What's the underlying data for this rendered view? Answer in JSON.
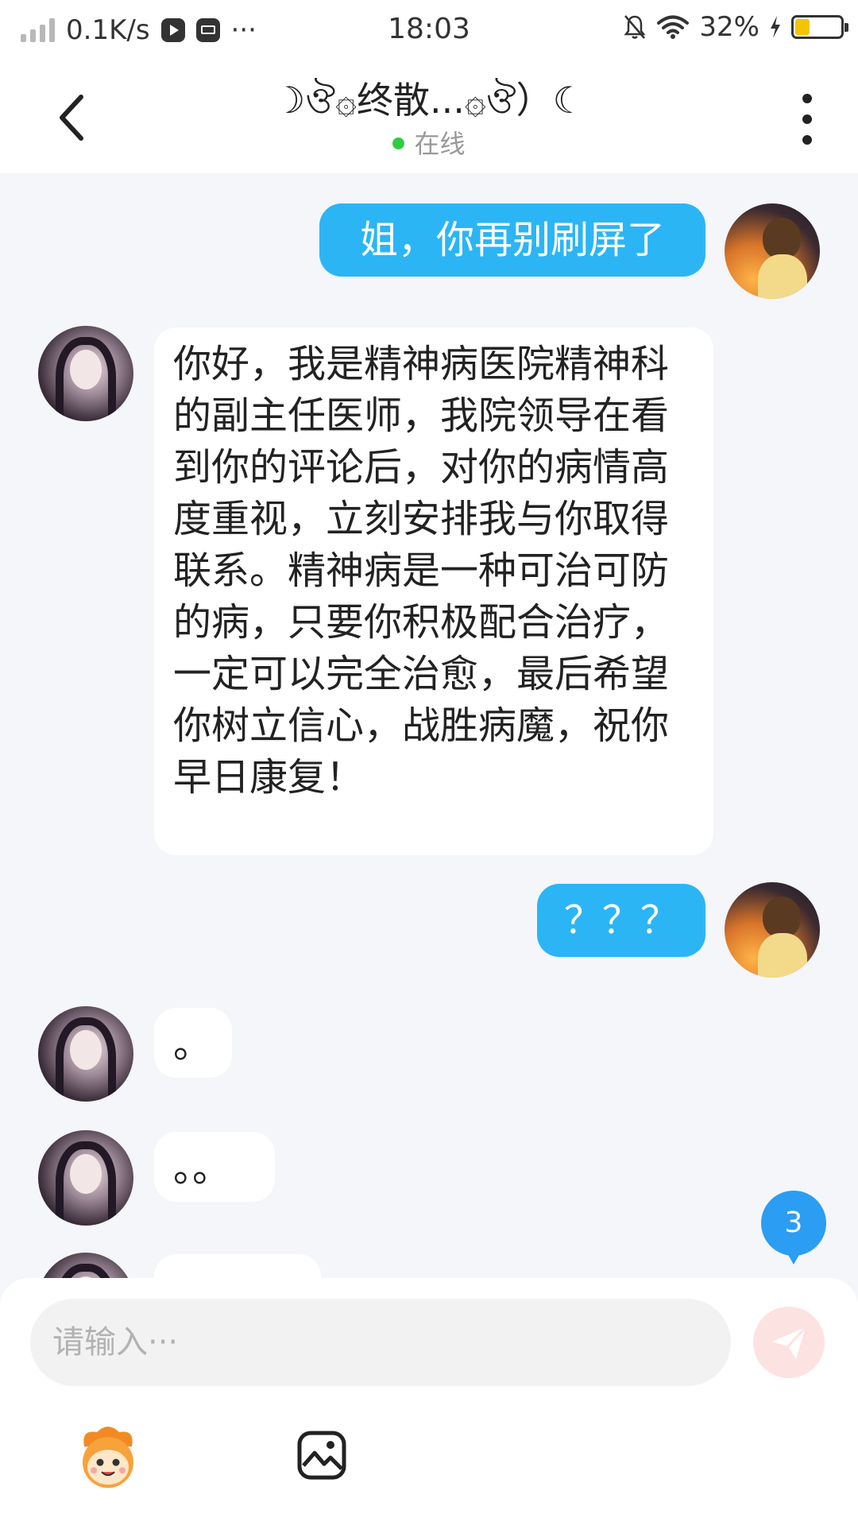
{
  "status_bar": {
    "network_speed": "0.1K/s",
    "more": "···",
    "time": "18:03",
    "battery_percent": "32%",
    "battery_level": 0.32,
    "icons": [
      "signal-icon",
      "video-app-icon",
      "mail-app-icon",
      "mute-bell-icon",
      "wifi-icon",
      "charging-icon",
      "battery-icon"
    ]
  },
  "header": {
    "title": "☽ঔ۞终散...۞ঔ）☾",
    "status": "在线",
    "status_color": "#2ecc40",
    "icons": [
      "back-icon",
      "more-vertical-icon"
    ]
  },
  "messages": [
    {
      "side": "sent",
      "text": "姐，你再别刷屏了"
    },
    {
      "side": "received",
      "text": "你好，我是精神病医院精神科的副主任医师，我院领导在看到你的评论后，对你的病情高度重视，立刻安排我与你取得联系。精神病是一种可治可防的病，只要你积极配合治疗，一定可以完全治愈，最后希望你树立信心，战胜病魔，祝你早日康复！"
    },
    {
      "side": "sent",
      "text": "？？？"
    },
    {
      "side": "received",
      "text": "。"
    },
    {
      "side": "received",
      "text": "。。"
    },
    {
      "side": "received",
      "text": ""
    }
  ],
  "unread_badge": "3",
  "input": {
    "placeholder": "请输入···",
    "value": ""
  },
  "toolbar": {
    "icons": [
      "emoji-icon",
      "image-icon",
      "send-icon"
    ]
  },
  "colors": {
    "sent_bubble": "#2bb5f5",
    "received_bubble": "#ffffff",
    "chat_background": "#f4f6f9",
    "badge": "#2b9df2",
    "send_button": "#fde2e2"
  }
}
